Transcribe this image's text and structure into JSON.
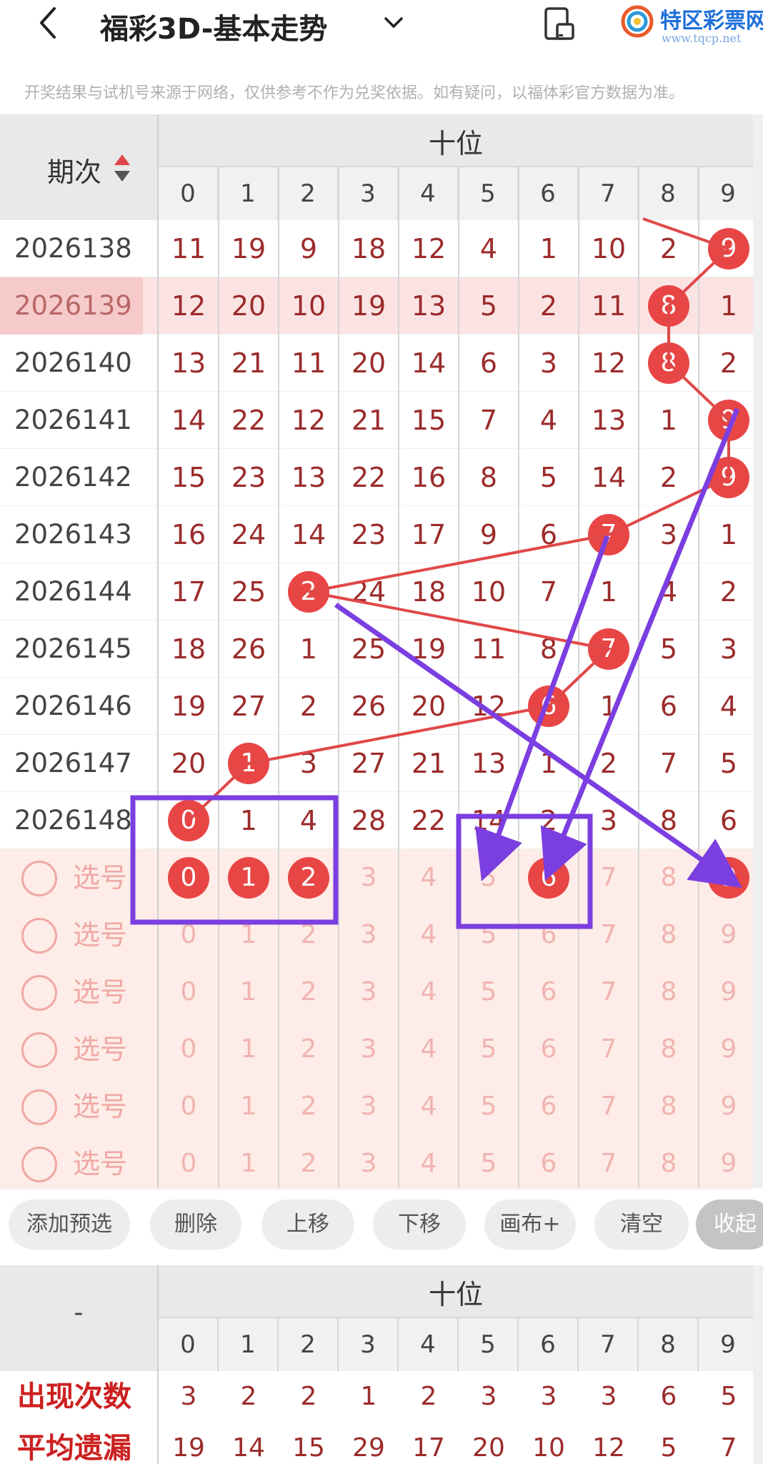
{
  "header": {
    "title": "福彩3D-基本走势",
    "logo_text": "特区彩票网",
    "logo_url": "www.tqcp.net"
  },
  "notice": "开奖结果与试机号来源于网络，仅供参考不作为兑奖依据。如有疑问，以福体彩官方数据为准。",
  "table": {
    "issue_header": "期次",
    "group_header": "十位",
    "digits": [
      "0",
      "1",
      "2",
      "3",
      "4",
      "5",
      "6",
      "7",
      "8",
      "9"
    ],
    "rows": [
      {
        "issue": "2026138",
        "cells": [
          "11",
          "19",
          "9",
          "18",
          "12",
          "4",
          "1",
          "10",
          "2",
          "9"
        ],
        "hit": 9
      },
      {
        "issue": "2026139",
        "cells": [
          "12",
          "20",
          "10",
          "19",
          "13",
          "5",
          "2",
          "11",
          "8",
          "1"
        ],
        "hit": 8
      },
      {
        "issue": "2026140",
        "cells": [
          "13",
          "21",
          "11",
          "20",
          "14",
          "6",
          "3",
          "12",
          "8",
          "2"
        ],
        "hit": 8
      },
      {
        "issue": "2026141",
        "cells": [
          "14",
          "22",
          "12",
          "21",
          "15",
          "7",
          "4",
          "13",
          "1",
          "9"
        ],
        "hit": 9
      },
      {
        "issue": "2026142",
        "cells": [
          "15",
          "23",
          "13",
          "22",
          "16",
          "8",
          "5",
          "14",
          "2",
          "9"
        ],
        "hit": 9
      },
      {
        "issue": "2026143",
        "cells": [
          "16",
          "24",
          "14",
          "23",
          "17",
          "9",
          "6",
          "7",
          "3",
          "1"
        ],
        "hit": 7
      },
      {
        "issue": "2026144",
        "cells": [
          "17",
          "25",
          "2",
          "24",
          "18",
          "10",
          "7",
          "1",
          "4",
          "2"
        ],
        "hit": 2
      },
      {
        "issue": "2026145",
        "cells": [
          "18",
          "26",
          "1",
          "25",
          "19",
          "11",
          "8",
          "7",
          "5",
          "3"
        ],
        "hit": 7
      },
      {
        "issue": "2026146",
        "cells": [
          "19",
          "27",
          "2",
          "26",
          "20",
          "12",
          "6",
          "1",
          "6",
          "4"
        ],
        "hit": 6
      },
      {
        "issue": "2026147",
        "cells": [
          "20",
          "1",
          "3",
          "27",
          "21",
          "13",
          "1",
          "2",
          "7",
          "5"
        ],
        "hit": 1
      },
      {
        "issue": "2026148",
        "cells": [
          "0",
          "1",
          "4",
          "28",
          "22",
          "14",
          "2",
          "3",
          "8",
          "6"
        ],
        "hit": 0
      }
    ],
    "pick_label": "选号",
    "pick_rows": 6,
    "pick_selected": [
      0,
      1,
      2,
      6,
      9
    ]
  },
  "buttons": [
    "添加预选",
    "删除",
    "上移",
    "下移",
    "画布+",
    "清空",
    "收起"
  ],
  "stats": {
    "dash": "-",
    "group_header": "十位",
    "rows": [
      {
        "label": "出现次数",
        "values": [
          "3",
          "2",
          "2",
          "1",
          "2",
          "3",
          "3",
          "3",
          "6",
          "5"
        ]
      },
      {
        "label": "平均遗漏",
        "values": [
          "19",
          "14",
          "15",
          "29",
          "17",
          "20",
          "10",
          "12",
          "5",
          "7"
        ]
      }
    ]
  },
  "colors": {
    "ball": "#e84545",
    "trend_line": "#e04848",
    "annotation": "#7b3ee0"
  }
}
